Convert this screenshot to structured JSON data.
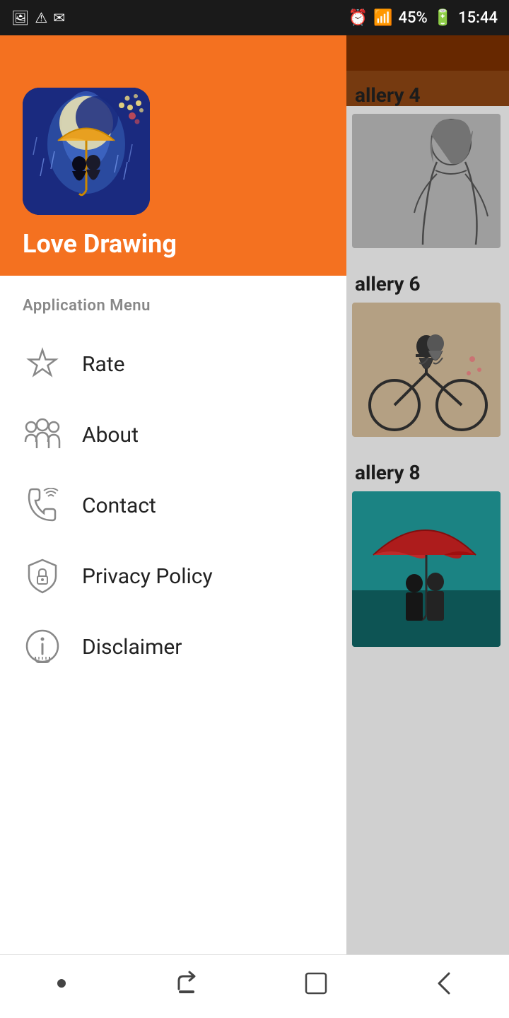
{
  "statusBar": {
    "leftIcons": [
      "🖼",
      "⚠",
      "✉"
    ],
    "rightText": "45%",
    "time": "15:44",
    "batteryIcon": "🔋"
  },
  "drawer": {
    "appName": "Love Drawing",
    "menuSectionLabel": "Application Menu",
    "menuItems": [
      {
        "id": "rate",
        "label": "Rate",
        "icon": "star"
      },
      {
        "id": "about",
        "label": "About",
        "icon": "people"
      },
      {
        "id": "contact",
        "label": "Contact",
        "icon": "contact"
      },
      {
        "id": "privacy",
        "label": "Privacy Policy",
        "icon": "shield"
      },
      {
        "id": "disclaimer",
        "label": "Disclaimer",
        "icon": "disclaimer"
      }
    ]
  },
  "gallery": {
    "sections": [
      {
        "label": "allery 4"
      },
      {
        "label": "allery 6"
      },
      {
        "label": "allery 8"
      }
    ]
  },
  "navBar": {
    "icons": [
      "dot",
      "recent",
      "home",
      "back"
    ]
  }
}
